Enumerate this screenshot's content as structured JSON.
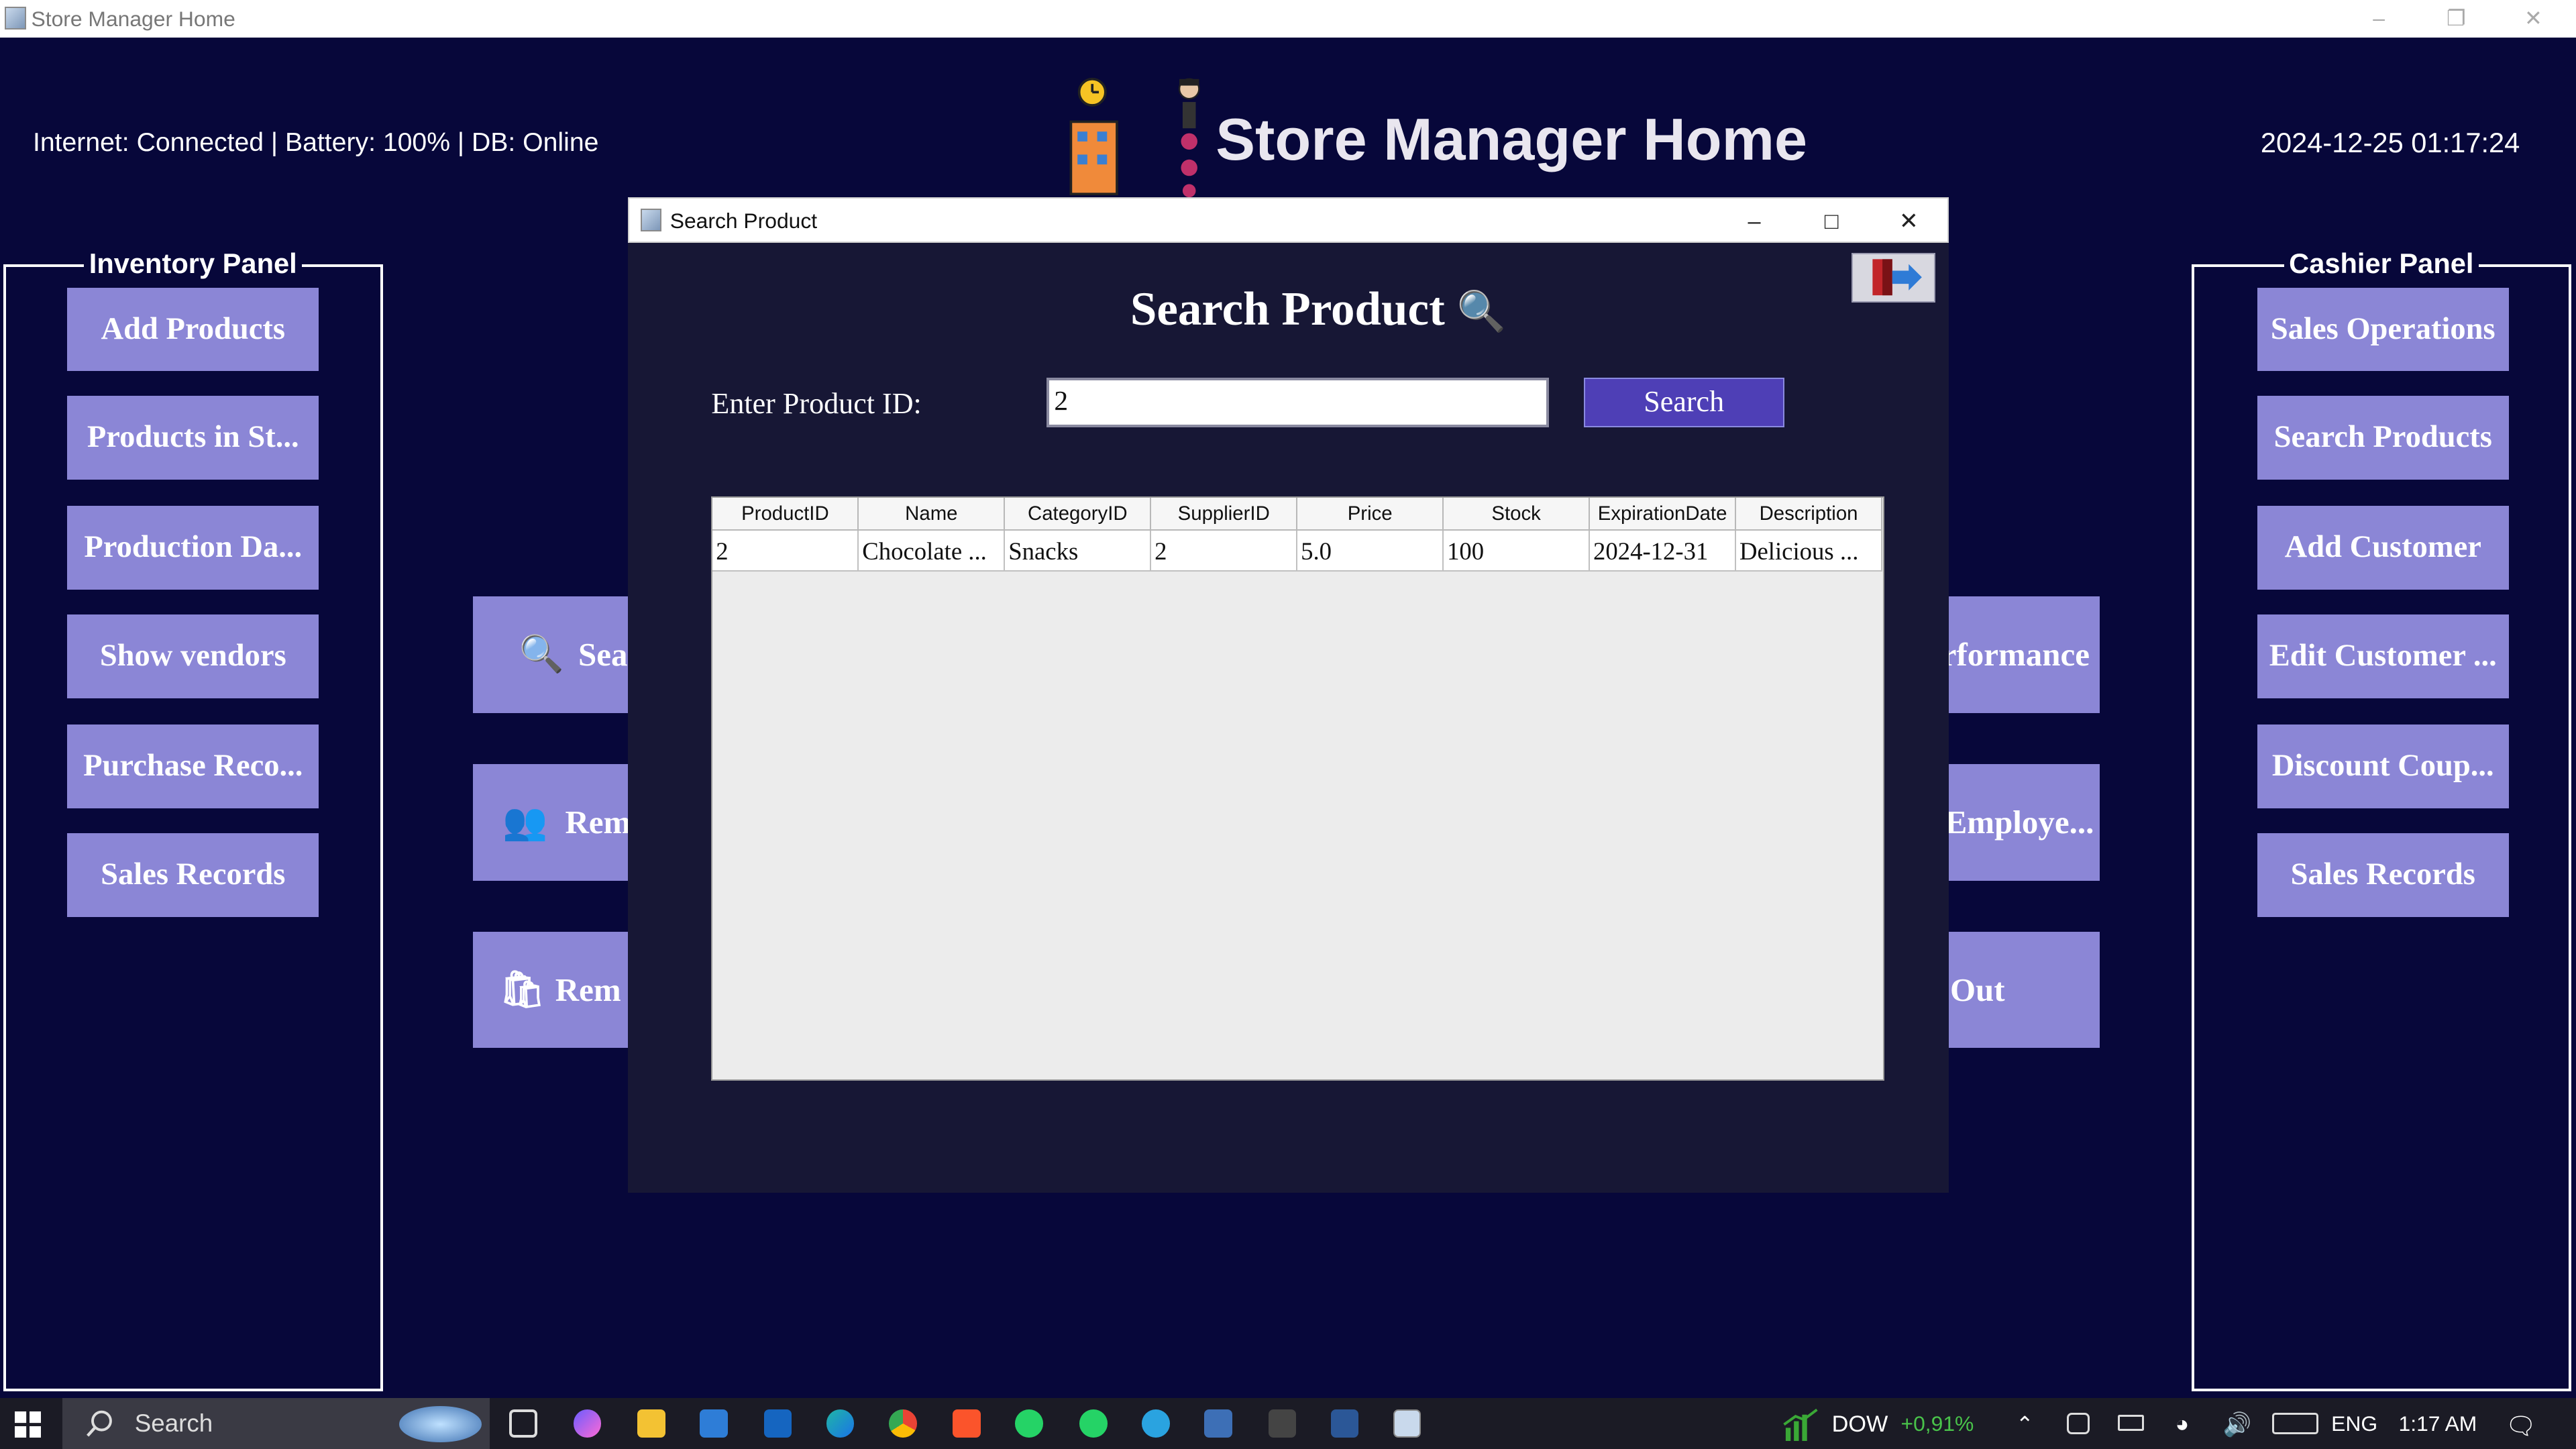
{
  "window": {
    "title": "Store Manager Home"
  },
  "header": {
    "status_text": "Internet: Connected | Battery: 100% | DB:  Online",
    "title": "Store Manager Home",
    "datetime": "2024-12-25 01:17:24"
  },
  "inventory_panel": {
    "title": "Inventory Panel",
    "buttons": [
      "Add Products",
      "Products in St...",
      "Production Da...",
      "Show vendors",
      "Purchase Reco...",
      "Sales Records"
    ]
  },
  "cashier_panel": {
    "title": "Cashier Panel",
    "buttons": [
      "Sales Operations",
      "Search Products",
      "Add Customer",
      "Edit Customer ...",
      "Discount Coup...",
      "Sales Records"
    ]
  },
  "center_buttons_left": [
    "Sea",
    "Rem",
    "Rem"
  ],
  "center_buttons_right": [
    "rformance",
    "Employe...",
    "Out"
  ],
  "dialog": {
    "window_title": "Search Product",
    "heading": "Search Product",
    "field_label": "Enter Product ID:",
    "field_value": "2",
    "search_button": "Search",
    "table": {
      "columns": [
        "ProductID",
        "Name",
        "CategoryID",
        "SupplierID",
        "Price",
        "Stock",
        "ExpirationDate",
        "Description"
      ],
      "rows": [
        [
          "2",
          "Chocolate ...",
          "Snacks",
          "2",
          "5.0",
          "100",
          "2024-12-31",
          "Delicious ..."
        ]
      ]
    }
  },
  "taskbar": {
    "search_label": "Search",
    "stock_ticker": "DOW",
    "stock_change": "+0,91%",
    "language": "ENG",
    "clock": "1:17 AM"
  }
}
